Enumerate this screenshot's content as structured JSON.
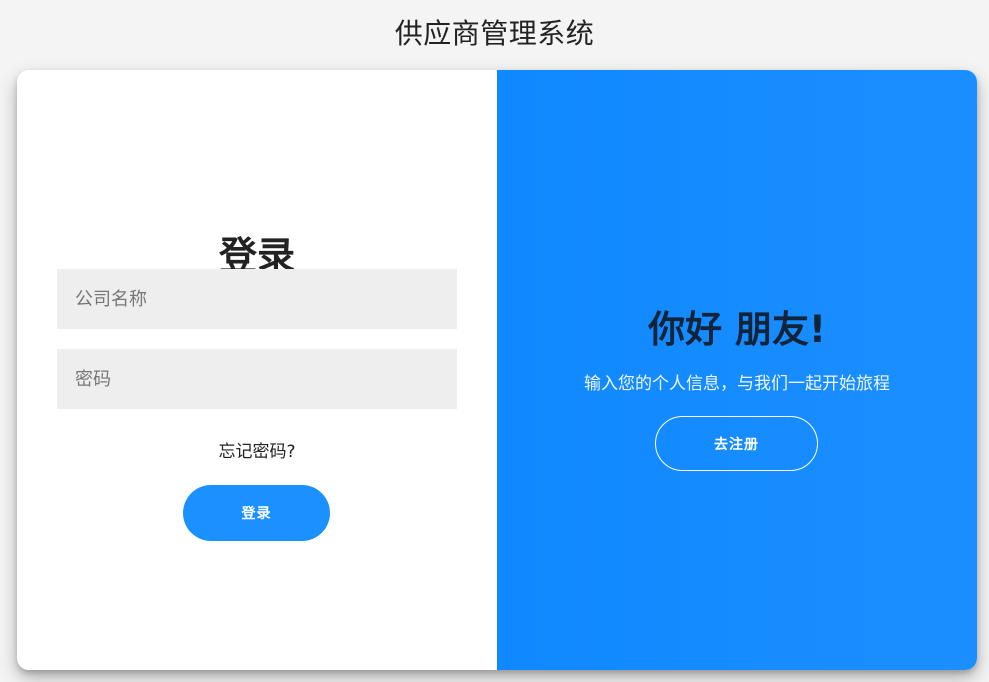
{
  "app": {
    "title": "供应商管理系统"
  },
  "login": {
    "heading": "登录",
    "company_placeholder": "公司名称",
    "password_placeholder": "密码",
    "forgot_password": "忘记密码?",
    "login_button": "登录"
  },
  "register": {
    "heading": "你好 朋友!",
    "message": "输入您的个人信息，与我们一起开始旅程",
    "register_button": "去注册"
  },
  "colors": {
    "accent_blue": "#1a8fff",
    "input_background": "#eeeeee",
    "page_background": "#f4f4f4"
  }
}
